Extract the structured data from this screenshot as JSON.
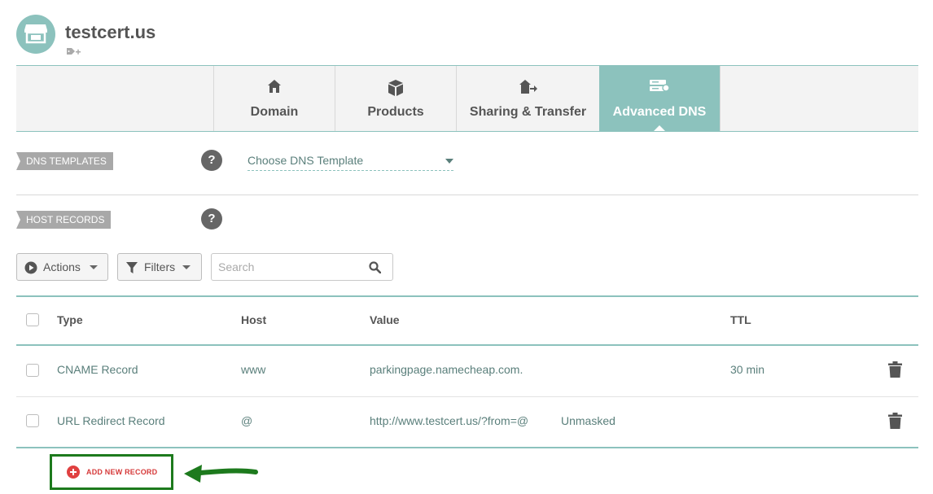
{
  "domain": {
    "name": "testcert.us"
  },
  "icons": {
    "store": "store-icon",
    "tag_add": "tag-add-icon",
    "home": "home-icon",
    "box": "box-icon",
    "share": "share-transfer-icon",
    "server": "server-icon",
    "play": "play-circle-icon",
    "filter": "filter-icon",
    "search": "search-icon",
    "trash": "trash-icon"
  },
  "tabs": [
    {
      "label": "Domain",
      "active": false
    },
    {
      "label": "Products",
      "active": false
    },
    {
      "label": "Sharing & Transfer",
      "active": false
    },
    {
      "label": "Advanced DNS",
      "active": true
    }
  ],
  "dns_templates": {
    "label": "DNS TEMPLATES",
    "help": "?",
    "select_value": "Choose DNS Template"
  },
  "host_records": {
    "label": "HOST RECORDS",
    "help": "?",
    "actions_label": "Actions",
    "filters_label": "Filters",
    "search_placeholder": "Search",
    "columns": [
      "Type",
      "Host",
      "Value",
      "TTL"
    ],
    "rows": [
      {
        "type": "CNAME Record",
        "host": "www",
        "value": "parkingpage.namecheap.com.",
        "extra": "",
        "ttl": "30 min"
      },
      {
        "type": "URL Redirect Record",
        "host": "@",
        "value": "http://www.testcert.us/?from=@",
        "extra": "Unmasked",
        "ttl": ""
      }
    ],
    "add_label": "ADD NEW RECORD"
  },
  "colors": {
    "accent": "#8cc2bd",
    "text": "#555555",
    "link": "#5a7f7b",
    "add_red": "#d63a3a",
    "highlight_green": "#1d7a1d"
  }
}
